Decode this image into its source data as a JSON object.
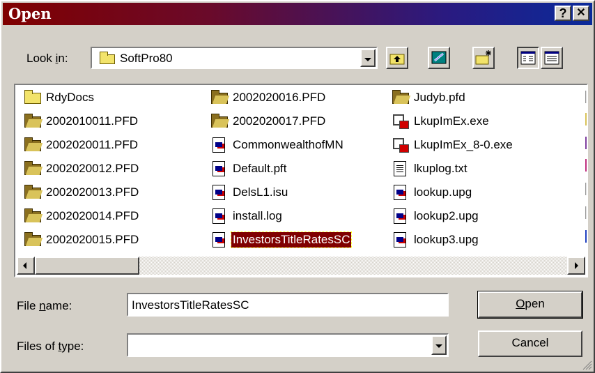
{
  "window": {
    "title": "Open",
    "help_label": "?",
    "close_label": "✕"
  },
  "lookin": {
    "label_pre": "Look ",
    "label_key": "i",
    "label_post": "n:",
    "value": "SoftPro80"
  },
  "toolbar": {
    "tools": [
      {
        "name": "up-one-level-button",
        "icon": "up-folder-icon"
      },
      {
        "name": "desktop-button",
        "icon": "desktop-icon"
      },
      {
        "name": "new-folder-button",
        "icon": "new-folder-icon"
      },
      {
        "name": "list-view-button",
        "icon": "list-view-icon",
        "pressed": true
      },
      {
        "name": "details-view-button",
        "icon": "details-view-icon"
      }
    ]
  },
  "files": {
    "columns": [
      [
        {
          "name": "RdyDocs",
          "icon": "folder"
        },
        {
          "name": "2002010011.PFD",
          "icon": "pfd"
        },
        {
          "name": "2002020011.PFD",
          "icon": "pfd"
        },
        {
          "name": "2002020012.PFD",
          "icon": "pfd"
        },
        {
          "name": "2002020013.PFD",
          "icon": "pfd"
        },
        {
          "name": "2002020014.PFD",
          "icon": "pfd"
        },
        {
          "name": "2002020015.PFD",
          "icon": "pfd"
        }
      ],
      [
        {
          "name": "2002020016.PFD",
          "icon": "pfd"
        },
        {
          "name": "2002020017.PFD",
          "icon": "pfd"
        },
        {
          "name": "CommonwealthofMN",
          "icon": "doc"
        },
        {
          "name": "Default.pft",
          "icon": "doc"
        },
        {
          "name": "DelsL1.isu",
          "icon": "doc"
        },
        {
          "name": "install.log",
          "icon": "doc"
        },
        {
          "name": "InvestorsTitleRatesSC",
          "icon": "doc",
          "selected": true
        }
      ],
      [
        {
          "name": "Judyb.pfd",
          "icon": "pfd"
        },
        {
          "name": "LkupImEx.exe",
          "icon": "exe"
        },
        {
          "name": "LkupImEx_8-0.exe",
          "icon": "exe"
        },
        {
          "name": "lkuplog.txt",
          "icon": "txt"
        },
        {
          "name": "lookup.upg",
          "icon": "doc"
        },
        {
          "name": "lookup2.upg",
          "icon": "doc"
        },
        {
          "name": "lookup3.upg",
          "icon": "doc"
        }
      ]
    ]
  },
  "filename": {
    "label_pre": "File ",
    "label_key": "n",
    "label_post": "ame:",
    "value": "InvestorsTitleRatesSC"
  },
  "filetype": {
    "label_pre": "Files of ",
    "label_key": "t",
    "label_post": "ype:",
    "value": ""
  },
  "buttons": {
    "open_key": "O",
    "open_rest": "pen",
    "cancel": "Cancel"
  },
  "colors": {
    "selection": "#800000",
    "title_start": "#800000",
    "title_end": "#0a2a9a"
  }
}
